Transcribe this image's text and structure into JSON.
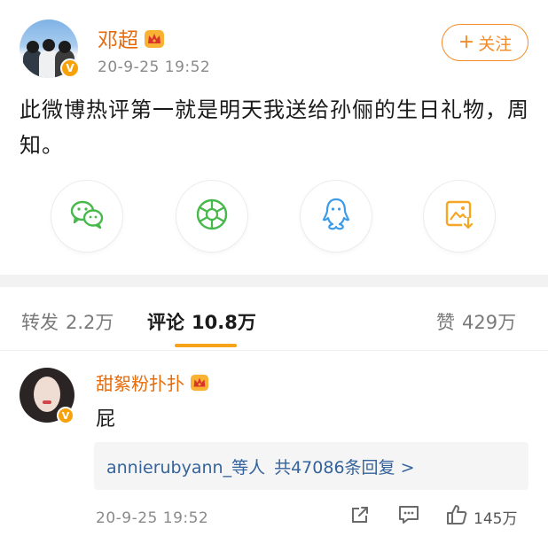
{
  "post": {
    "username": "邓超",
    "time": "20-9-25 19:52",
    "follow_label": "关注",
    "text": "此微博热评第一就是明天我送给孙俪的生日礼物，周知。",
    "share_icons": [
      "wechat-icon",
      "moments-icon",
      "qq-icon",
      "save-image-icon"
    ]
  },
  "tabs": [
    {
      "label": "转发",
      "count": "2.2万"
    },
    {
      "label": "评论",
      "count": "10.8万"
    },
    {
      "label": "赞",
      "count": "429万"
    }
  ],
  "comment": {
    "username": "甜絮粉扑扑",
    "text": "屁",
    "reply_users": "annierubyann_等人",
    "reply_more": "共47086条回复 >",
    "time": "20-9-25 19:52",
    "like_count": "145万"
  },
  "colors": {
    "accent_orange": "#f28c2a",
    "username_orange": "#e86b0a",
    "link_blue": "#35639b",
    "tab_underline": "#f7a31a",
    "verified_badge": "#f7a10b"
  }
}
